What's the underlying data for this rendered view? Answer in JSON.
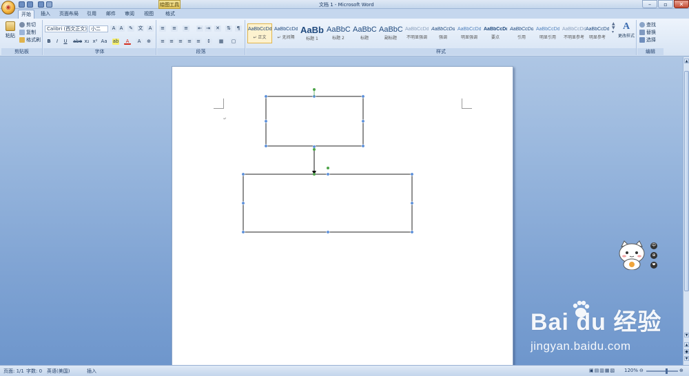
{
  "window": {
    "title": "文档 1 - Microsoft Word",
    "context_tool": "绘图工具",
    "controls": [
      "–",
      "▫",
      "✕"
    ]
  },
  "tabs": [
    "开始",
    "插入",
    "页面布局",
    "引用",
    "邮件",
    "审阅",
    "视图",
    "格式"
  ],
  "active_tab": "开始",
  "clipboard": {
    "paste_label": "粘贴",
    "cut_label": "剪切",
    "copy_label": "复制",
    "format_painter_label": "格式刷",
    "group_label": "剪贴板"
  },
  "font": {
    "font_name": "Calibri (西文正文)",
    "font_size": "小二",
    "group_label": "字体",
    "format_buttons": [
      "B",
      "I",
      "U",
      "abe",
      "x₂",
      "x²",
      "Aa",
      "A"
    ]
  },
  "paragraph": {
    "group_label": "段落"
  },
  "styles": {
    "group_label": "样式",
    "items": [
      {
        "sample": "AaBbCcDd",
        "name": "↵ 正文",
        "selected": true
      },
      {
        "sample": "AaBbCcDd",
        "name": "↵ 无间隔",
        "selected": false
      },
      {
        "sample": "AaBb",
        "name": "标题 1",
        "selected": false
      },
      {
        "sample": "AaBbC",
        "name": "标题 2",
        "selected": false
      },
      {
        "sample": "AaBbC",
        "name": "标题",
        "selected": false
      },
      {
        "sample": "AaBbC",
        "name": "副标题",
        "selected": false
      },
      {
        "sample": "AaBbCcDd",
        "name": "不明显强调",
        "selected": false
      },
      {
        "sample": "AaBbCcDd",
        "name": "强调",
        "selected": false
      },
      {
        "sample": "AaBbCcDd",
        "name": "明显强调",
        "selected": false
      },
      {
        "sample": "AaBbCcDd",
        "name": "要点",
        "selected": false
      },
      {
        "sample": "AaBbCcDd",
        "name": "引用",
        "selected": false
      },
      {
        "sample": "AaBbCcDd",
        "name": "明显引用",
        "selected": false
      },
      {
        "sample": "AaBbCcDd",
        "name": "不明显参考",
        "selected": false
      },
      {
        "sample": "AaBbCcDd",
        "name": "明显参考",
        "selected": false
      }
    ],
    "change_styles_label": "更改样式"
  },
  "editing": {
    "find_label": "查找",
    "replace_label": "替换",
    "select_label": "选择",
    "group_label": "编辑"
  },
  "statusbar": {
    "page": "页面: 1/1",
    "words": "字数: 0",
    "language": "英语(美国)",
    "mode": "插入",
    "zoom": "120%"
  },
  "side_icons": [
    "中",
    "⊕",
    "❤"
  ],
  "watermark": {
    "brand": "Bai du 经验",
    "url": "jingyan.baidu.com"
  },
  "colors": {
    "accent": "#2a5699",
    "selection_handle": "#5b8fd9",
    "rotate_handle": "#4ea44a",
    "ribbon_bg": "#dbe7f6",
    "workspace": "#8fb0db"
  },
  "icons": [
    "office-orb-icon",
    "save-icon",
    "undo-icon",
    "redo-icon",
    "paste-icon",
    "scissors-icon",
    "copy-icon",
    "brush-icon",
    "find-icon",
    "replace-icon",
    "select-icon",
    "cat-mascot",
    "paw-icon"
  ]
}
